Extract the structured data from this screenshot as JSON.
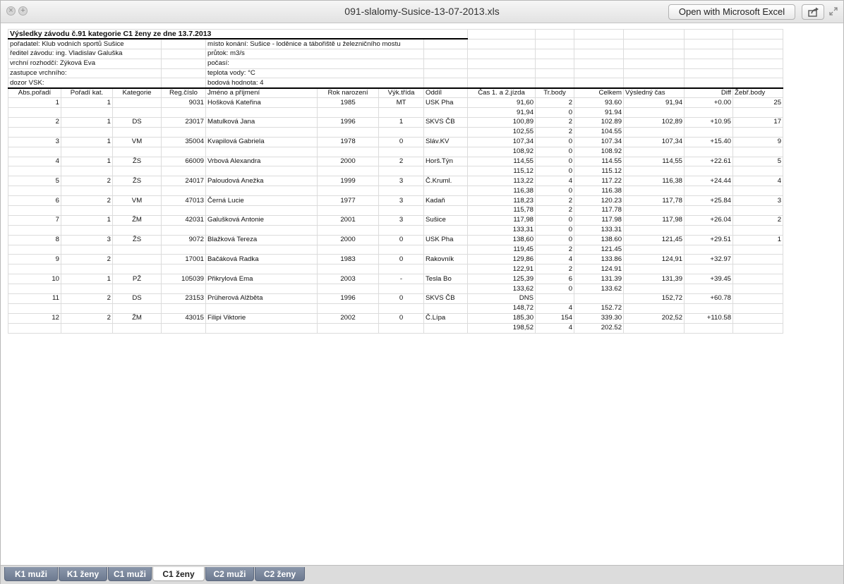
{
  "window": {
    "title": "091-slalomy-Susice-13-07-2013.xls",
    "open_button": "Open with Microsoft Excel"
  },
  "sheet": {
    "title": "Výsledky závodu č.91 kategorie C1 ženy ze dne 13.7.2013",
    "info_left": [
      "pořadatel: Klub vodních sportů Sušice",
      "ředitel závodu: ing. Vladislav Galuška",
      "vrchní rozhodčí: Zýková Eva",
      "zastupce vrchního:",
      "dozor VSK:"
    ],
    "info_right": [
      "místo konání: Sušice - loděnice a tábořiště u železničního mostu",
      "průtok:  m3/s",
      "počasí:",
      "teplota vody:  °C",
      "bodová hodnota: 4"
    ],
    "columns": [
      "Abs.pořadí",
      "Pořadí kat.",
      "Kategorie",
      "Reg.číslo",
      "Jméno a příjmení",
      "Rok narození",
      "Výk.třída",
      "Oddíl",
      "Čas 1. a 2.jízda",
      "Tr.body",
      "Celkem",
      "Výsledný čas",
      "Diff",
      "Žebř.body"
    ],
    "rows": [
      [
        "1",
        "1",
        "",
        "9031",
        "Hošková Kateřina",
        "1985",
        "MT",
        "USK Pha",
        "91,60",
        "2",
        "93.60",
        "91,94",
        "+0.00",
        "25"
      ],
      [
        "",
        "",
        "",
        "",
        "",
        "",
        "",
        "",
        "91,94",
        "0",
        "91.94",
        "",
        "",
        ""
      ],
      [
        "2",
        "1",
        "DS",
        "23017",
        "Matulková Jana",
        "1996",
        "1",
        "SKVS ČB",
        "100,89",
        "2",
        "102.89",
        "102,89",
        "+10.95",
        "17"
      ],
      [
        "",
        "",
        "",
        "",
        "",
        "",
        "",
        "",
        "102,55",
        "2",
        "104.55",
        "",
        "",
        ""
      ],
      [
        "3",
        "1",
        "VM",
        "35004",
        "Kvapilová Gabriela",
        "1978",
        "0",
        "Sláv.KV",
        "107,34",
        "0",
        "107.34",
        "107,34",
        "+15.40",
        "9"
      ],
      [
        "",
        "",
        "",
        "",
        "",
        "",
        "",
        "",
        "108,92",
        "0",
        "108.92",
        "",
        "",
        ""
      ],
      [
        "4",
        "1",
        "ŽS",
        "66009",
        "Vrbová Alexandra",
        "2000",
        "2",
        "Horš.Týn",
        "114,55",
        "0",
        "114.55",
        "114,55",
        "+22.61",
        "5"
      ],
      [
        "",
        "",
        "",
        "",
        "",
        "",
        "",
        "",
        "115,12",
        "0",
        "115.12",
        "",
        "",
        ""
      ],
      [
        "5",
        "2",
        "ŽS",
        "24017",
        "Paloudová Anežka",
        "1999",
        "3",
        "Č.Kruml.",
        "113,22",
        "4",
        "117.22",
        "116,38",
        "+24.44",
        "4"
      ],
      [
        "",
        "",
        "",
        "",
        "",
        "",
        "",
        "",
        "116,38",
        "0",
        "116.38",
        "",
        "",
        ""
      ],
      [
        "6",
        "2",
        "VM",
        "47013",
        "Černá Lucie",
        "1977",
        "3",
        "Kadaň",
        "118,23",
        "2",
        "120.23",
        "117,78",
        "+25.84",
        "3"
      ],
      [
        "",
        "",
        "",
        "",
        "",
        "",
        "",
        "",
        "115,78",
        "2",
        "117.78",
        "",
        "",
        ""
      ],
      [
        "7",
        "1",
        "ŽM",
        "42031",
        "Galušková Antonie",
        "2001",
        "3",
        "Sušice",
        "117,98",
        "0",
        "117.98",
        "117,98",
        "+26.04",
        "2"
      ],
      [
        "",
        "",
        "",
        "",
        "",
        "",
        "",
        "",
        "133,31",
        "0",
        "133.31",
        "",
        "",
        ""
      ],
      [
        "8",
        "3",
        "ŽS",
        "9072",
        "Blažková Tereza",
        "2000",
        "0",
        "USK Pha",
        "138,60",
        "0",
        "138.60",
        "121,45",
        "+29.51",
        "1"
      ],
      [
        "",
        "",
        "",
        "",
        "",
        "",
        "",
        "",
        "119,45",
        "2",
        "121.45",
        "",
        "",
        ""
      ],
      [
        "9",
        "2",
        "",
        "17001",
        "Bačáková Radka",
        "1983",
        "0",
        "Rakovník",
        "129,86",
        "4",
        "133.86",
        "124,91",
        "+32.97",
        ""
      ],
      [
        "",
        "",
        "",
        "",
        "",
        "",
        "",
        "",
        "122,91",
        "2",
        "124.91",
        "",
        "",
        ""
      ],
      [
        "10",
        "1",
        "PŽ",
        "105039",
        "Přikrylová Ema",
        "2003",
        "-",
        "Tesla Bo",
        "125,39",
        "6",
        "131.39",
        "131,39",
        "+39.45",
        ""
      ],
      [
        "",
        "",
        "",
        "",
        "",
        "",
        "",
        "",
        "133,62",
        "0",
        "133.62",
        "",
        "",
        ""
      ],
      [
        "11",
        "2",
        "DS",
        "23153",
        "Prüherová Alžběta",
        "1996",
        "0",
        "SKVS ČB",
        "DNS",
        "",
        "",
        "152,72",
        "+60.78",
        ""
      ],
      [
        "",
        "",
        "",
        "",
        "",
        "",
        "",
        "",
        "148,72",
        "4",
        "152.72",
        "",
        "",
        ""
      ],
      [
        "12",
        "2",
        "ŽM",
        "43015",
        "Filipi Viktorie",
        "2002",
        "0",
        "Č.Lípa",
        "185,30",
        "154",
        "339.30",
        "202,52",
        "+110.58",
        ""
      ],
      [
        "",
        "",
        "",
        "",
        "",
        "",
        "",
        "",
        "198,52",
        "4",
        "202.52",
        "",
        "",
        ""
      ]
    ]
  },
  "tabs": [
    {
      "label": "K1 muži",
      "active": false
    },
    {
      "label": "K1 ženy",
      "active": false
    },
    {
      "label": "C1 muži",
      "active": false
    },
    {
      "label": "C1 ženy",
      "active": true
    },
    {
      "label": "C2 muži",
      "active": false
    },
    {
      "label": "C2 ženy",
      "active": false
    }
  ]
}
